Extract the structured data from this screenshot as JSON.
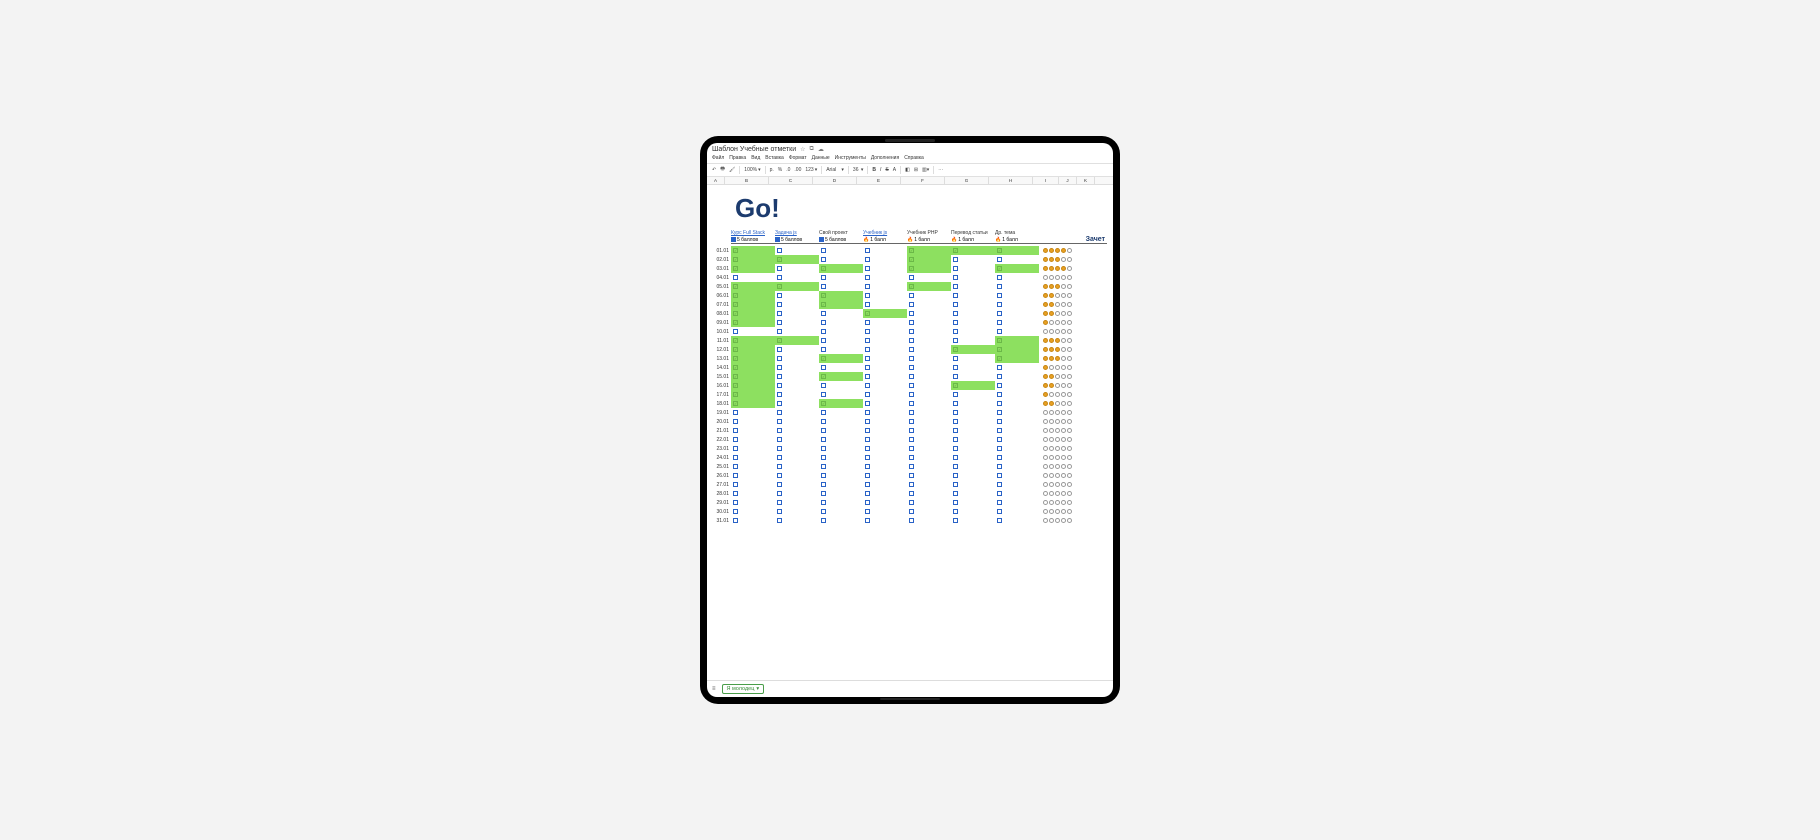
{
  "doc_title": "Шаблон Учебные отметки",
  "menu": [
    "Файл",
    "Правка",
    "Вид",
    "Вставка",
    "Формат",
    "Данные",
    "Инструменты",
    "Дополнения",
    "Справка"
  ],
  "toolbar": {
    "zoom": "100%",
    "currency": "р.",
    "percent": "%",
    "dec": ".0",
    "dec2": ".00",
    "fmt": "123",
    "font": "Arial",
    "size": "36"
  },
  "col_letters": [
    "A",
    "B",
    "C",
    "D",
    "E",
    "F",
    "G",
    "H",
    "I",
    "J",
    "K"
  ],
  "big_title": "Go!",
  "columns": [
    {
      "label": "Курс Full Stack",
      "link": true,
      "sub": "5 баллов",
      "icon": "sq"
    },
    {
      "label": "Задача js",
      "link": true,
      "sub": "5 баллов",
      "icon": "sq"
    },
    {
      "label": "Свой проект",
      "link": false,
      "sub": "5 баллов",
      "icon": "sq"
    },
    {
      "label": "Учебник js",
      "link": true,
      "sub": "1 балл",
      "icon": "fire"
    },
    {
      "label": "Учебник PHP",
      "link": false,
      "sub": "1 балл",
      "icon": "fire"
    },
    {
      "label": "Перевод статьи",
      "link": false,
      "sub": "1 балл",
      "icon": "fire"
    },
    {
      "label": "Др. тема",
      "link": false,
      "sub": "1 балл",
      "icon": "fire"
    }
  ],
  "zachet": "Зачет",
  "rows": [
    {
      "d": "01.01",
      "c": [
        1,
        0,
        0,
        0,
        1,
        1,
        1
      ],
      "s": 4
    },
    {
      "d": "02.01",
      "c": [
        1,
        1,
        0,
        0,
        1,
        0,
        0
      ],
      "s": 3
    },
    {
      "d": "03.01",
      "c": [
        1,
        0,
        1,
        0,
        1,
        0,
        1
      ],
      "s": 4
    },
    {
      "d": "04.01",
      "c": [
        0,
        0,
        0,
        0,
        0,
        0,
        0
      ],
      "s": 0
    },
    {
      "d": "05.01",
      "c": [
        1,
        1,
        0,
        0,
        1,
        0,
        0
      ],
      "s": 3
    },
    {
      "d": "06.01",
      "c": [
        1,
        0,
        1,
        0,
        0,
        0,
        0
      ],
      "s": 2
    },
    {
      "d": "07.01",
      "c": [
        1,
        0,
        1,
        0,
        0,
        0,
        0
      ],
      "s": 2
    },
    {
      "d": "08.01",
      "c": [
        1,
        0,
        0,
        1,
        0,
        0,
        0
      ],
      "s": 2
    },
    {
      "d": "09.01",
      "c": [
        1,
        0,
        0,
        0,
        0,
        0,
        0
      ],
      "s": 1
    },
    {
      "d": "10.01",
      "c": [
        0,
        0,
        0,
        0,
        0,
        0,
        0
      ],
      "s": 0
    },
    {
      "d": "11.01",
      "c": [
        1,
        1,
        0,
        0,
        0,
        0,
        1
      ],
      "s": 3
    },
    {
      "d": "12.01",
      "c": [
        1,
        0,
        0,
        0,
        0,
        1,
        1
      ],
      "s": 3
    },
    {
      "d": "13.01",
      "c": [
        1,
        0,
        1,
        0,
        0,
        0,
        1
      ],
      "s": 3
    },
    {
      "d": "14.01",
      "c": [
        1,
        0,
        0,
        0,
        0,
        0,
        0
      ],
      "s": 1
    },
    {
      "d": "15.01",
      "c": [
        1,
        0,
        1,
        0,
        0,
        0,
        0
      ],
      "s": 2
    },
    {
      "d": "16.01",
      "c": [
        1,
        0,
        0,
        0,
        0,
        1,
        0
      ],
      "s": 2
    },
    {
      "d": "17.01",
      "c": [
        1,
        0,
        0,
        0,
        0,
        0,
        0
      ],
      "s": 1
    },
    {
      "d": "18.01",
      "c": [
        1,
        0,
        1,
        0,
        0,
        0,
        0
      ],
      "s": 2
    },
    {
      "d": "19.01",
      "c": [
        0,
        0,
        0,
        0,
        0,
        0,
        0
      ],
      "s": 0
    },
    {
      "d": "20.01",
      "c": [
        0,
        0,
        0,
        0,
        0,
        0,
        0
      ],
      "s": 0
    },
    {
      "d": "21.01",
      "c": [
        0,
        0,
        0,
        0,
        0,
        0,
        0
      ],
      "s": 0
    },
    {
      "d": "22.01",
      "c": [
        0,
        0,
        0,
        0,
        0,
        0,
        0
      ],
      "s": 0
    },
    {
      "d": "23.01",
      "c": [
        0,
        0,
        0,
        0,
        0,
        0,
        0
      ],
      "s": 0
    },
    {
      "d": "24.01",
      "c": [
        0,
        0,
        0,
        0,
        0,
        0,
        0
      ],
      "s": 0
    },
    {
      "d": "25.01",
      "c": [
        0,
        0,
        0,
        0,
        0,
        0,
        0
      ],
      "s": 0
    },
    {
      "d": "26.01",
      "c": [
        0,
        0,
        0,
        0,
        0,
        0,
        0
      ],
      "s": 0
    },
    {
      "d": "27.01",
      "c": [
        0,
        0,
        0,
        0,
        0,
        0,
        0
      ],
      "s": 0
    },
    {
      "d": "28.01",
      "c": [
        0,
        0,
        0,
        0,
        0,
        0,
        0
      ],
      "s": 0
    },
    {
      "d": "29.01",
      "c": [
        0,
        0,
        0,
        0,
        0,
        0,
        0
      ],
      "s": 0
    },
    {
      "d": "30.01",
      "c": [
        0,
        0,
        0,
        0,
        0,
        0,
        0
      ],
      "s": 0
    },
    {
      "d": "31.01",
      "c": [
        0,
        0,
        0,
        0,
        0,
        0,
        0
      ],
      "s": 0
    }
  ],
  "max_dots": 5,
  "tab_label": "Я молодец"
}
